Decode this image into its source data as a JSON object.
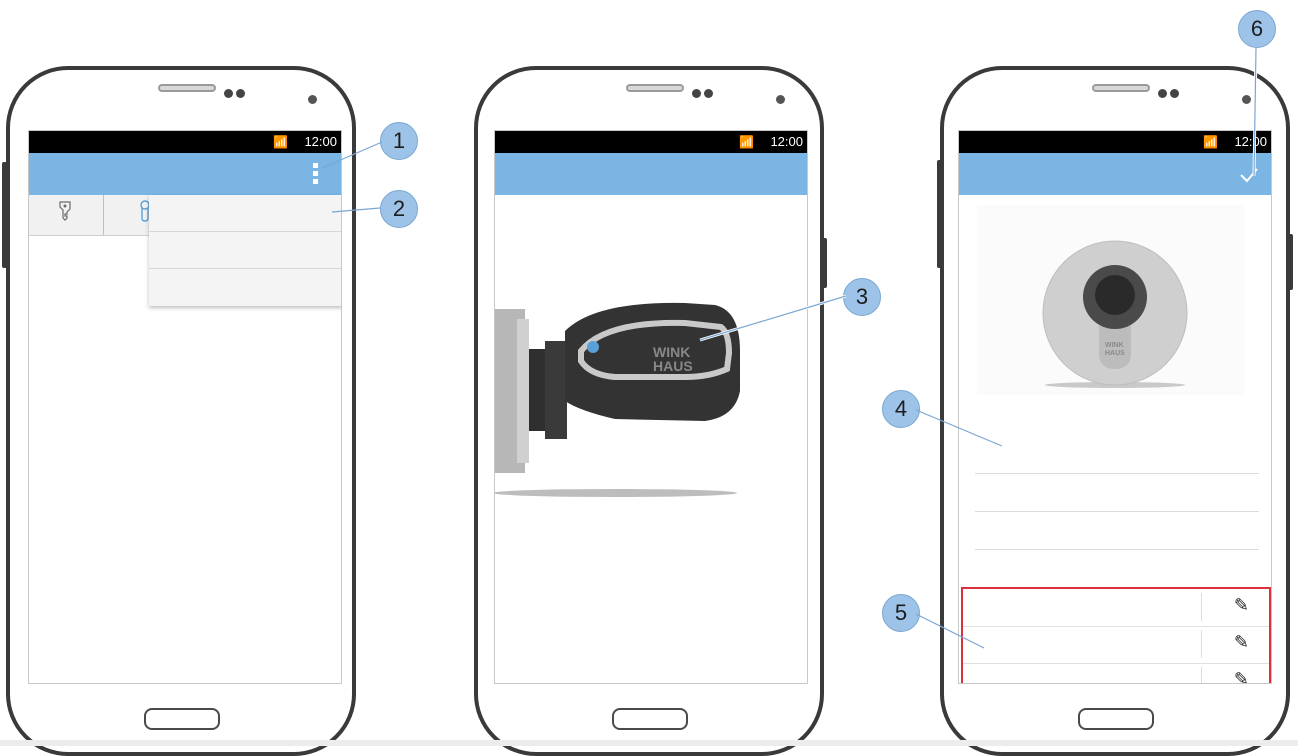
{
  "status_bar": {
    "time": "12:00",
    "icons": "wifi-icon signal-icon battery-icon"
  },
  "callouts": [
    "1",
    "2",
    "3",
    "4",
    "5",
    "6"
  ],
  "screen1": {
    "tabs": [
      {
        "icon": "key-icon"
      },
      {
        "icon": "cylinder-icon"
      }
    ],
    "menu_items": [
      "",
      "",
      ""
    ],
    "overflow_icon": "overflow-menu-icon"
  },
  "screen2": {
    "image": "winkhaus-key-in-cylinder-image",
    "brand_text": "WINK HAUS"
  },
  "screen3": {
    "confirm_icon": "checkmark-icon",
    "image": "lock-cylinder-image",
    "brand_text": "WINK HAUS",
    "fields": [
      "",
      "",
      ""
    ],
    "edit_rows": [
      {
        "icon": "pencil-icon"
      },
      {
        "icon": "pencil-icon"
      },
      {
        "icon": "pencil-icon"
      }
    ],
    "highlight_color": "#d9323d"
  },
  "colors": {
    "appbar": "#7ab5e3",
    "callout": "#9dc4e8"
  }
}
